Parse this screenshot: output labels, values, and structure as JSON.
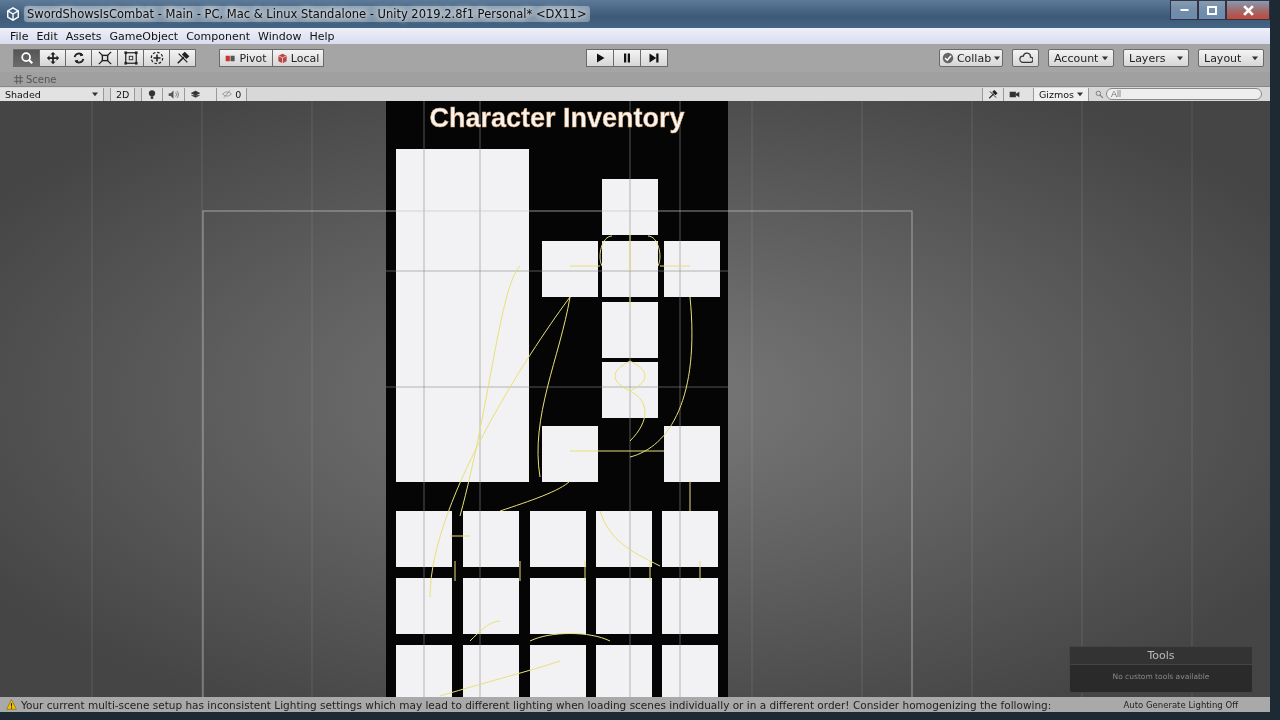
{
  "window": {
    "title": "SwordShowsIsCombat - Main - PC, Mac & Linux Standalone - Unity 2019.2.8f1 Personal* <DX11>"
  },
  "menu": [
    "File",
    "Edit",
    "Assets",
    "GameObject",
    "Component",
    "Window",
    "Help"
  ],
  "tools": [
    {
      "kind": "view",
      "selected": true
    },
    {
      "kind": "move",
      "selected": false
    },
    {
      "kind": "rotate",
      "selected": false
    },
    {
      "kind": "scale",
      "selected": false
    },
    {
      "kind": "rect",
      "selected": false
    },
    {
      "kind": "transform",
      "selected": false
    },
    {
      "kind": "custom",
      "selected": false
    }
  ],
  "pivot_buttons": [
    {
      "kind": "pivot",
      "label": "Pivot"
    },
    {
      "kind": "local",
      "label": "Local"
    }
  ],
  "play_buttons": [
    {
      "kind": "play"
    },
    {
      "kind": "pause"
    },
    {
      "kind": "step"
    }
  ],
  "right_buttons": [
    {
      "kind": "collab",
      "label": "Collab"
    },
    {
      "kind": "cloud"
    },
    {
      "kind": "dropdown",
      "label": "Account"
    },
    {
      "kind": "dropdown",
      "label": "Layers"
    },
    {
      "kind": "dropdown",
      "label": "Layout"
    }
  ],
  "scene_tab": {
    "label": "Scene"
  },
  "scene_toolbar": {
    "shading": "Shaded",
    "mode_2d": {
      "label": "2D",
      "on": false
    },
    "hidden_count": "0",
    "gizmos": "Gizmos",
    "search": {
      "placeholder": "All"
    }
  },
  "canvas": {
    "title": "Character Inventory"
  },
  "tools_panel": {
    "title": "Tools",
    "message": "No custom tools available"
  },
  "status_bar": {
    "message": "Your current multi-scene setup has inconsistent Lighting settings which may lead to different lighting when loading scenes individually or in a different order! Consider homogenizing the following:",
    "lighting": "Auto Generate Lighting Off"
  }
}
